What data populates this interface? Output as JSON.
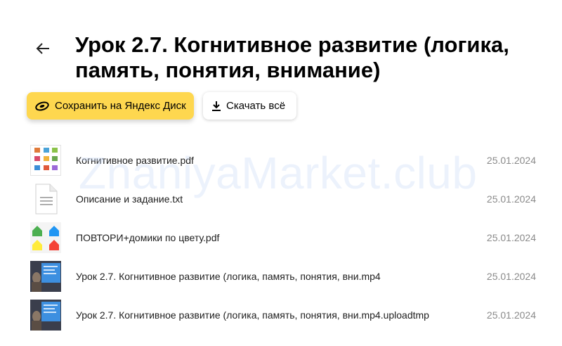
{
  "header": {
    "back_icon": "arrow-left-icon",
    "title": "Урок 2.7. Когнитивное развитие (логика, память, понятия, внимание)"
  },
  "actions": {
    "save_label": "Сохранить на Яндекс Диск",
    "save_icon": "yandex-disk-icon",
    "download_label": "Скачать всё",
    "download_icon": "download-icon"
  },
  "watermark": "ZnaniyaMarket.club",
  "colors": {
    "accent_yellow": "#fed74f",
    "date_gray": "#8a8a8a"
  },
  "files": [
    {
      "name": "Когнитивное развитие.pdf",
      "date": "25.01.2024",
      "thumb": "pdf-thumbnail"
    },
    {
      "name": "Описание и задание.txt",
      "date": "25.01.2024",
      "thumb": "text-file-icon"
    },
    {
      "name": "ПОВТОРИ+домики по цвету.pdf",
      "date": "25.01.2024",
      "thumb": "pdf-thumbnail"
    },
    {
      "name": "Урок 2.7. Когнитивное развитие (логика, память, понятия, вни.mp4",
      "date": "25.01.2024",
      "thumb": "video-thumbnail"
    },
    {
      "name": "Урок 2.7. Когнитивное развитие (логика, память, понятия, вни.mp4.uploadtmp",
      "date": "25.01.2024",
      "thumb": "video-thumbnail"
    }
  ]
}
